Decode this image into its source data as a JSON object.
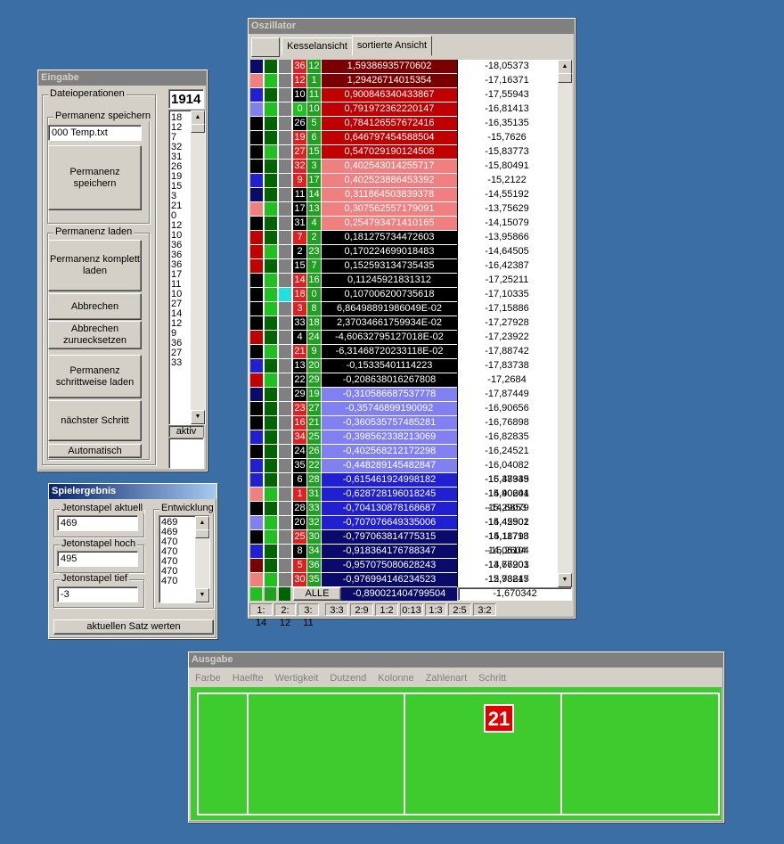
{
  "eingabe": {
    "title": "Eingabe",
    "group_datei": "Dateioperationen",
    "group_speichern": "Permanenz speichern",
    "filename": "000 Temp.txt",
    "btn_speichern": "Permanenz speichern",
    "group_laden": "Permanenz laden",
    "btn_komplett": "Permanenz komplett laden",
    "btn_abbrechen": "Abbrechen",
    "btn_abbrechen_reset": "Abbrechen zuruecksetzen",
    "btn_schrittweise": "Permanenz schrittweise laden",
    "btn_naechster": "nächster Schritt",
    "btn_automatisch": "Automatisch",
    "count": "1914",
    "numbers": [
      "18",
      "12",
      "7",
      "32",
      "31",
      "26",
      "19",
      "15",
      "3",
      "21",
      "0",
      "12",
      "10",
      "36",
      "36",
      "36",
      "17",
      "11",
      "10",
      "27",
      "14",
      "12",
      "9",
      "36",
      "27",
      "33"
    ],
    "status": "aktiv"
  },
  "spielergebnis": {
    "title": "Spielergebnis",
    "label_aktuell": "Jetonstapel aktuell",
    "value_aktuell": "469",
    "label_hoch": "Jetonstapel hoch",
    "value_hoch": "495",
    "label_tief": "Jetonstapel tief",
    "value_tief": "-3",
    "label_entwicklung": "Entwicklung",
    "entwicklung": [
      "469",
      "469",
      "470",
      "470",
      "470",
      "470",
      "470"
    ],
    "btn_werten": "aktuellen Satz werten"
  },
  "oszillator": {
    "title": "Oszillator",
    "tab_kessel": "Kesselansicht",
    "tab_sortiert": "sortierte Ansicht",
    "rows": [
      {
        "c1": "#0a0a6a",
        "c2": "#006400",
        "c3": "#808080",
        "a": "36",
        "ac": "#e02020",
        "b": "12",
        "bc": "#20a020",
        "val": "1,59386935770602",
        "vbg": "#7a0000",
        "vfg": "#ffffff",
        "dev": "-18,05373"
      },
      {
        "c1": "#f08080",
        "c2": "#20c020",
        "c3": "#808080",
        "a": "12",
        "ac": "#e02020",
        "b": "1",
        "bc": "#20a020",
        "val": "1,29426714015354",
        "vbg": "#7a0000",
        "vfg": "#ffffff",
        "dev": "-17,16371"
      },
      {
        "c1": "#2020d0",
        "c2": "#006400",
        "c3": "#808080",
        "a": "10",
        "ac": "#000000",
        "b": "11",
        "bc": "#20a020",
        "val": "0,900846340433867",
        "vbg": "#c00000",
        "vfg": "#ffffff",
        "dev": "-17,55943"
      },
      {
        "c1": "#8080f0",
        "c2": "#20c020",
        "c3": "#808080",
        "a": "0",
        "ac": "#20c020",
        "b": "10",
        "bc": "#20a020",
        "val": "0,791972362220147",
        "vbg": "#c00000",
        "vfg": "#ffffff",
        "dev": "-16,81413"
      },
      {
        "c1": "#000000",
        "c2": "#006400",
        "c3": "#808080",
        "a": "26",
        "ac": "#000000",
        "b": "5",
        "bc": "#20a020",
        "val": "0,784126557672416",
        "vbg": "#c00000",
        "vfg": "#ffffff",
        "dev": "-16,35135"
      },
      {
        "c1": "#000000",
        "c2": "#006400",
        "c3": "#808080",
        "a": "19",
        "ac": "#e02020",
        "b": "6",
        "bc": "#20a020",
        "val": "0,646797454588504",
        "vbg": "#c00000",
        "vfg": "#ffffff",
        "dev": "-15,7626"
      },
      {
        "c1": "#000000",
        "c2": "#20c020",
        "c3": "#808080",
        "a": "27",
        "ac": "#e02020",
        "b": "15",
        "bc": "#20a020",
        "val": "0,547029190124508",
        "vbg": "#c00000",
        "vfg": "#ffffff",
        "dev": "-15,83773"
      },
      {
        "c1": "#000000",
        "c2": "#006400",
        "c3": "#808080",
        "a": "32",
        "ac": "#e02020",
        "b": "3",
        "bc": "#20a020",
        "val": "0,402543014255717",
        "vbg": "#f08080",
        "vfg": "#ffffff",
        "dev": "-15,80491"
      },
      {
        "c1": "#2020d0",
        "c2": "#006400",
        "c3": "#808080",
        "a": "9",
        "ac": "#e02020",
        "b": "17",
        "bc": "#20a020",
        "val": "0,402523886453392",
        "vbg": "#f08080",
        "vfg": "#ffffff",
        "dev": "-15,2122"
      },
      {
        "c1": "#0a0a6a",
        "c2": "#006400",
        "c3": "#808080",
        "a": "11",
        "ac": "#000000",
        "b": "14",
        "bc": "#20a020",
        "val": "0,311864503839378",
        "vbg": "#f08080",
        "vfg": "#ffffff",
        "dev": "-14,55192"
      },
      {
        "c1": "#f08080",
        "c2": "#20c020",
        "c3": "#808080",
        "a": "17",
        "ac": "#000000",
        "b": "13",
        "bc": "#20a020",
        "val": "0,307562557179091",
        "vbg": "#f08080",
        "vfg": "#ffffff",
        "dev": "-13,75629"
      },
      {
        "c1": "#000000",
        "c2": "#006400",
        "c3": "#808080",
        "a": "31",
        "ac": "#000000",
        "b": "4",
        "bc": "#20a020",
        "val": "0,254793471410165",
        "vbg": "#f08080",
        "vfg": "#ffffff",
        "dev": "-14,15079"
      },
      {
        "c1": "#c00000",
        "c2": "#006400",
        "c3": "#808080",
        "a": "7",
        "ac": "#e02020",
        "b": "2",
        "bc": "#20a020",
        "val": "0,181275734472603",
        "vbg": "#000000",
        "vfg": "#ffffff",
        "dev": "-13,95866"
      },
      {
        "c1": "#c00000",
        "c2": "#20c020",
        "c3": "#808080",
        "a": "2",
        "ac": "#000000",
        "b": "23",
        "bc": "#20a020",
        "val": "0,170224699018483",
        "vbg": "#000000",
        "vfg": "#ffffff",
        "dev": "-14,64505"
      },
      {
        "c1": "#c00000",
        "c2": "#006400",
        "c3": "#808080",
        "a": "15",
        "ac": "#000000",
        "b": "7",
        "bc": "#20a020",
        "val": "0,152593134735435",
        "vbg": "#000000",
        "vfg": "#ffffff",
        "dev": "-16,42387"
      },
      {
        "c1": "#000000",
        "c2": "#20c020",
        "c3": "#808080",
        "a": "14",
        "ac": "#e02020",
        "b": "16",
        "bc": "#20a020",
        "val": "0,11245921831312",
        "vbg": "#000000",
        "vfg": "#ffffff",
        "dev": "-17,25211"
      },
      {
        "c1": "#000000",
        "c2": "#20c020",
        "c3": "#20e0e0",
        "a": "18",
        "ac": "#e02020",
        "b": "0",
        "bc": "#20a020",
        "val": "0,107006200735618",
        "vbg": "#000000",
        "vfg": "#ffffff",
        "dev": "-17,10335"
      },
      {
        "c1": "#000000",
        "c2": "#20c020",
        "c3": "#808080",
        "a": "3",
        "ac": "#e02020",
        "b": "8",
        "bc": "#20a020",
        "val": "6,86498891986049E-02",
        "vbg": "#000000",
        "vfg": "#ffffff",
        "dev": "-17,15886"
      },
      {
        "c1": "#000000",
        "c2": "#006400",
        "c3": "#808080",
        "a": "33",
        "ac": "#000000",
        "b": "18",
        "bc": "#20a020",
        "val": "2,37034661759934E-02",
        "vbg": "#000000",
        "vfg": "#ffffff",
        "dev": "-17,27928"
      },
      {
        "c1": "#c00000",
        "c2": "#006400",
        "c3": "#808080",
        "a": "4",
        "ac": "#000000",
        "b": "24",
        "bc": "#20a020",
        "val": "-4,60632795127018E-02",
        "vbg": "#000000",
        "vfg": "#ffffff",
        "dev": "-17,23922"
      },
      {
        "c1": "#000000",
        "c2": "#20c020",
        "c3": "#808080",
        "a": "21",
        "ac": "#e02020",
        "b": "9",
        "bc": "#20a020",
        "val": "-6,31468720233118E-02",
        "vbg": "#000000",
        "vfg": "#ffffff",
        "dev": "-17,88742"
      },
      {
        "c1": "#2020d0",
        "c2": "#006400",
        "c3": "#808080",
        "a": "13",
        "ac": "#000000",
        "b": "20",
        "bc": "#20a020",
        "val": "-0,15335401114223",
        "vbg": "#000000",
        "vfg": "#ffffff",
        "dev": "-17,83738"
      },
      {
        "c1": "#c00000",
        "c2": "#20c020",
        "c3": "#808080",
        "a": "22",
        "ac": "#000000",
        "b": "29",
        "bc": "#20a020",
        "val": "-0,208638016267808",
        "vbg": "#000000",
        "vfg": "#ffffff",
        "dev": "-17,2684"
      },
      {
        "c1": "#0a0a6a",
        "c2": "#006400",
        "c3": "#808080",
        "a": "29",
        "ac": "#000000",
        "b": "19",
        "bc": "#20a020",
        "val": "-0,310586687537778",
        "vbg": "#8080f0",
        "vfg": "#ffffff",
        "dev": "-17,87449"
      },
      {
        "c1": "#000000",
        "c2": "#006400",
        "c3": "#808080",
        "a": "23",
        "ac": "#e02020",
        "b": "27",
        "bc": "#20a020",
        "val": "-0,35746899190092",
        "vbg": "#8080f0",
        "vfg": "#ffffff",
        "dev": "-16,90656"
      },
      {
        "c1": "#000000",
        "c2": "#006400",
        "c3": "#808080",
        "a": "16",
        "ac": "#e02020",
        "b": "21",
        "bc": "#20a020",
        "val": "-0,360535757485281",
        "vbg": "#8080f0",
        "vfg": "#ffffff",
        "dev": "-16,76898"
      },
      {
        "c1": "#2020d0",
        "c2": "#006400",
        "c3": "#808080",
        "a": "34",
        "ac": "#e02020",
        "b": "25",
        "bc": "#20a020",
        "val": "-0,398562338213069",
        "vbg": "#8080f0",
        "vfg": "#ffffff",
        "dev": "-16,82835"
      },
      {
        "c1": "#000000",
        "c2": "#006400",
        "c3": "#808080",
        "a": "24",
        "ac": "#000000",
        "b": "26",
        "bc": "#20a020",
        "val": "-0,402568212172298",
        "vbg": "#8080f0",
        "vfg": "#ffffff",
        "dev": "-16,24521"
      },
      {
        "c1": "#2020d0",
        "c2": "#006400",
        "c3": "#808080",
        "a": "35",
        "ac": "#000000",
        "b": "22",
        "bc": "#20a020",
        "val": "-0,448289145482847",
        "vbg": "#8080f0",
        "vfg": "#ffffff",
        "dev": "-16,04082"
      },
      {
        "c1": "#2020d0",
        "c2": "#006400",
        "c3": "#808080",
        "a": "6",
        "ac": "#000000",
        "b": "28",
        "bc": "#20a020",
        "val": "-0,615461924998182",
        "vbg": "#2020d0",
        "vfg": "#ffffff",
        "dev": "-15,47945"
      },
      {
        "c1": "#f08080",
        "c2": "#20c020",
        "c3": "#808080",
        "a": "1",
        "ac": "#e02020",
        "b": "31",
        "bc": "#20a020",
        "val": "-0,628728196018245",
        "vbg": "#2020d0",
        "vfg": "#ffffff",
        "dev": "-14,90644"
      },
      {
        "c1": "#000000",
        "c2": "#006400",
        "c3": "#808080",
        "a": "28",
        "ac": "#000000",
        "b": "33",
        "bc": "#20a020",
        "val": "-0,704130878168687",
        "vbg": "#2020d0",
        "vfg": "#ffffff",
        "dev": "-15,29079"
      },
      {
        "c1": "#8080f0",
        "c2": "#20c020",
        "c3": "#808080",
        "a": "20",
        "ac": "#000000",
        "b": "32",
        "bc": "#20a020",
        "val": "-0,707076649335006",
        "vbg": "#2020d0",
        "vfg": "#ffffff",
        "dev": "-15,45502"
      },
      {
        "c1": "#000000",
        "c2": "#20c020",
        "c3": "#808080",
        "a": "25",
        "ac": "#e02020",
        "b": "30",
        "bc": "#20a020",
        "val": "-0,797063814775315",
        "vbg": "#0a0a6a",
        "vfg": "#ffffff",
        "dev": "-15,11718"
      },
      {
        "c1": "#2020d0",
        "c2": "#006400",
        "c3": "#808080",
        "a": "8",
        "ac": "#000000",
        "b": "34",
        "bc": "#20a020",
        "val": "-0,918364176788347",
        "vbg": "#0a0a6a",
        "vfg": "#ffffff",
        "dev": "-15,2604"
      },
      {
        "c1": "#7a0000",
        "c2": "#006400",
        "c3": "#808080",
        "a": "5",
        "ac": "#e02020",
        "b": "36",
        "bc": "#20a020",
        "val": "-0,957075080628243",
        "vbg": "#0a0a6a",
        "vfg": "#ffffff",
        "dev": "-14,67203"
      },
      {
        "c1": "#f08080",
        "c2": "#20c020",
        "c3": "#808080",
        "a": "30",
        "ac": "#e02020",
        "b": "35",
        "bc": "#20a020",
        "val": "-0,976994146234523",
        "vbg": "#0a0a6a",
        "vfg": "#ffffff",
        "dev": "-15,78217"
      }
    ],
    "extra_devs": [
      "-16,38339",
      "-15,40201",
      "-14,6853",
      "-14,42901",
      "-14,18793",
      "-14,06104",
      "-13,76901",
      "-12,93845"
    ],
    "footer_label": "ALLE",
    "footer_value": "-0,890021404799504",
    "footer_dev": "-1,670342",
    "status_cells": [
      "1: 14",
      "2: 12",
      "3: 11",
      "3:3",
      "2:9",
      "1:2",
      "0:13",
      "1:3",
      "2:5",
      "3:2"
    ]
  },
  "ausgabe": {
    "title": "Ausgabe",
    "menu": [
      "Farbe",
      "Haelfte",
      "Wertigkeit",
      "Dutzend",
      "Kolonne",
      "Zahlenart",
      "Schritt"
    ],
    "number": "21",
    "table_color": "#3ecb2d"
  }
}
